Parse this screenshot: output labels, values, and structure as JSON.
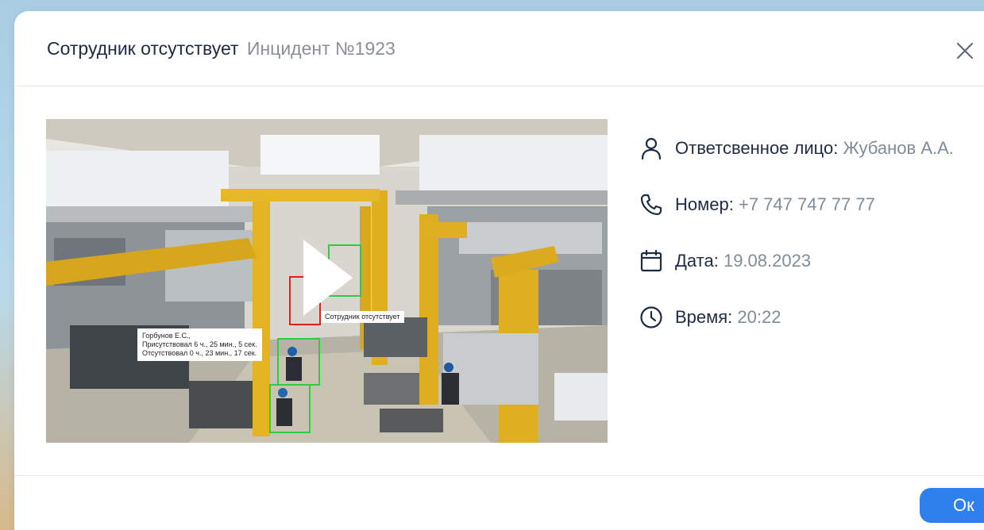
{
  "modal": {
    "title": "Сотрудник отсутствует",
    "subtitle": "Инцидент №1923",
    "close_icon": "close-icon"
  },
  "video": {
    "play_icon": "play-icon",
    "absent_label": "Сотрудник отсутствует",
    "person_label_lines": [
      "Горбунов Е.С.,",
      "Присутствовал 6 ч., 25 мин., 5 сек.",
      "Отсутствовал 0 ч., 23 мин., 17 сек."
    ]
  },
  "details": [
    {
      "icon": "user-icon",
      "label": "Ответсвенное лицо:",
      "value": "Жубанов А.А."
    },
    {
      "icon": "phone-icon",
      "label": "Номер:",
      "value": "+7 747 747 77 77"
    },
    {
      "icon": "calendar-icon",
      "label": "Дата:",
      "value": "19.08.2023"
    },
    {
      "icon": "clock-icon",
      "label": "Время:",
      "value": "20:22"
    }
  ],
  "footer": {
    "ok_label": "Ок"
  },
  "colors": {
    "accent": "#2f80ed",
    "text_primary": "#1f2a44",
    "text_secondary": "#7f8c99",
    "detection_ok": "#2ecc40",
    "detection_alert": "#e02020"
  }
}
